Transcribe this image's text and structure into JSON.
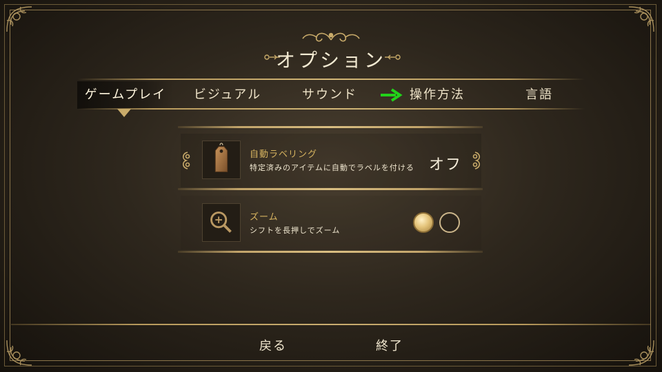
{
  "header": {
    "title": "オプション"
  },
  "tabs": [
    {
      "label": "ゲームプレイ",
      "active": true
    },
    {
      "label": "ビジュアル",
      "active": false
    },
    {
      "label": "サウンド",
      "active": false
    },
    {
      "label": "操作方法",
      "active": false
    },
    {
      "label": "言語",
      "active": false
    }
  ],
  "options": [
    {
      "title": "自動ラベリング",
      "description": "特定済みのアイテムに自動でラベルを付ける",
      "value": "オフ",
      "icon": "tag-icon"
    },
    {
      "title": "ズーム",
      "description": "シフトを長押しでズーム",
      "selected_option": 1,
      "option_count": 2,
      "icon": "magnifier-icon"
    }
  ],
  "footer": {
    "back_label": "戻る",
    "quit_label": "終了"
  },
  "colors": {
    "accent_gold": "#d6b35f",
    "arrow_green": "#22d11a",
    "frame_gold": "#b89a5c"
  }
}
